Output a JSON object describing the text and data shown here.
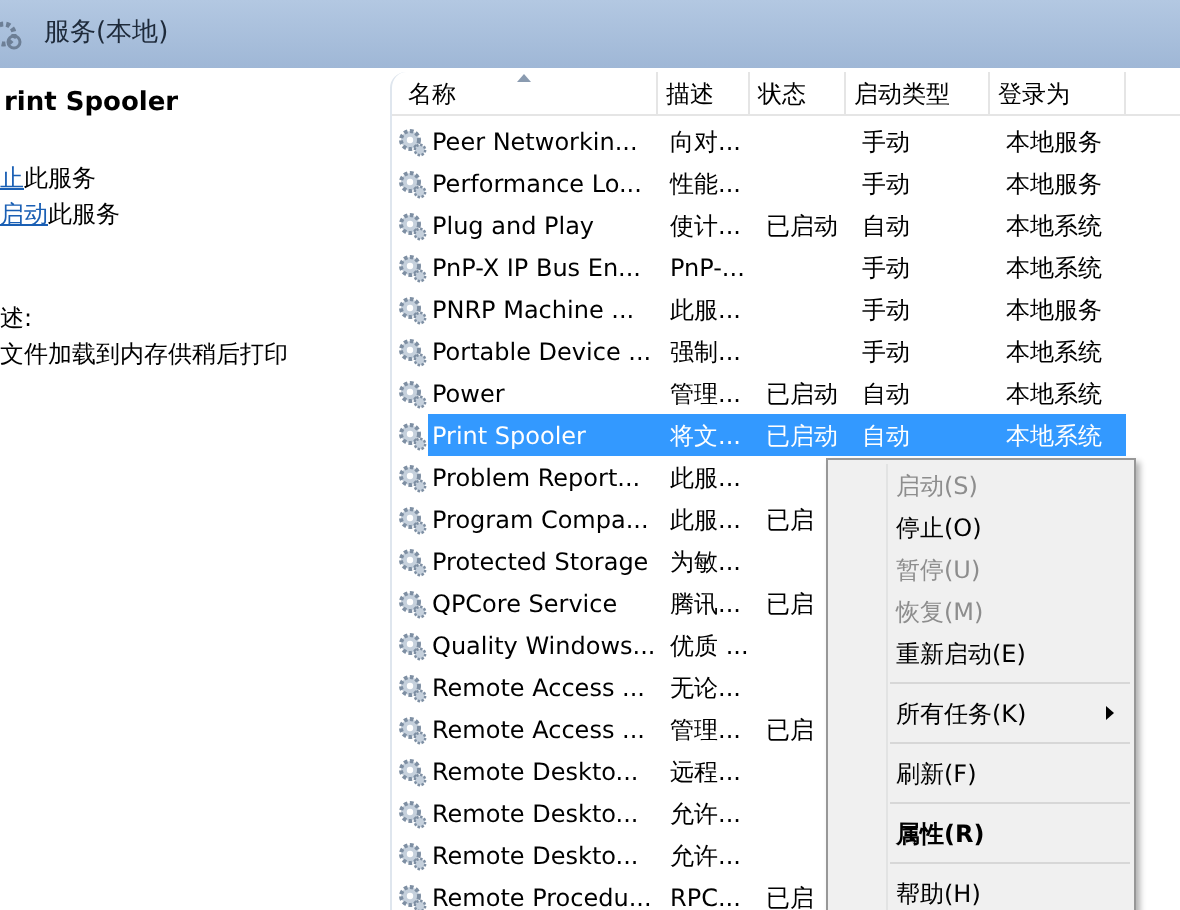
{
  "window": {
    "title": "服务(本地)"
  },
  "details": {
    "service_name": "rint Spooler",
    "actions": [
      {
        "link": "止",
        "text": "此服务"
      },
      {
        "link": "启动",
        "text": "此服务"
      }
    ],
    "description_label": "述:",
    "description": "文件加载到内存供稍后打印"
  },
  "table": {
    "columns": [
      {
        "label": "名称",
        "sorted": true
      },
      {
        "label": "描述",
        "sorted": false
      },
      {
        "label": "状态",
        "sorted": false
      },
      {
        "label": "启动类型",
        "sorted": false
      },
      {
        "label": "登录为",
        "sorted": false
      }
    ],
    "rows": [
      {
        "name": "Peer Networkin...",
        "description": "向对...",
        "status": "",
        "startup": "手动",
        "logon": "本地服务",
        "selected": false
      },
      {
        "name": "Performance Lo...",
        "description": "性能...",
        "status": "",
        "startup": "手动",
        "logon": "本地服务",
        "selected": false
      },
      {
        "name": "Plug and Play",
        "description": "使计...",
        "status": "已启动",
        "startup": "自动",
        "logon": "本地系统",
        "selected": false
      },
      {
        "name": "PnP-X IP Bus En...",
        "description": "PnP-...",
        "status": "",
        "startup": "手动",
        "logon": "本地系统",
        "selected": false
      },
      {
        "name": "PNRP Machine ...",
        "description": "此服...",
        "status": "",
        "startup": "手动",
        "logon": "本地服务",
        "selected": false
      },
      {
        "name": "Portable Device ...",
        "description": "强制...",
        "status": "",
        "startup": "手动",
        "logon": "本地系统",
        "selected": false
      },
      {
        "name": "Power",
        "description": "管理...",
        "status": "已启动",
        "startup": "自动",
        "logon": "本地系统",
        "selected": false
      },
      {
        "name": "Print Spooler",
        "description": "将文...",
        "status": "已启动",
        "startup": "自动",
        "logon": "本地系统",
        "selected": true
      },
      {
        "name": "Problem Report...",
        "description": "此服...",
        "status": "",
        "selected": false
      },
      {
        "name": "Program Compa...",
        "description": "此服...",
        "status": "已启",
        "selected": false
      },
      {
        "name": "Protected Storage",
        "description": "为敏...",
        "status": "",
        "selected": false
      },
      {
        "name": "QPCore Service",
        "description": "腾讯...",
        "status": "已启",
        "selected": false
      },
      {
        "name": "Quality Windows...",
        "description": "优质 ...",
        "status": "",
        "selected": false
      },
      {
        "name": "Remote Access ...",
        "description": "无论...",
        "status": "",
        "selected": false
      },
      {
        "name": "Remote Access ...",
        "description": "管理...",
        "status": "已启",
        "selected": false
      },
      {
        "name": "Remote Deskto...",
        "description": "远程...",
        "status": "",
        "selected": false
      },
      {
        "name": "Remote Deskto...",
        "description": "允许...",
        "status": "",
        "selected": false
      },
      {
        "name": "Remote Deskto...",
        "description": "允许...",
        "status": "",
        "selected": false
      },
      {
        "name": "Remote Procedu...",
        "description": "RPC...",
        "status": "已启",
        "selected": false
      }
    ]
  },
  "context_menu": {
    "items": [
      {
        "kind": "item",
        "label": "启动(S)",
        "disabled": true,
        "bold": false,
        "submenu": false
      },
      {
        "kind": "item",
        "label": "停止(O)",
        "disabled": false,
        "bold": false,
        "submenu": false
      },
      {
        "kind": "item",
        "label": "暂停(U)",
        "disabled": true,
        "bold": false,
        "submenu": false
      },
      {
        "kind": "item",
        "label": "恢复(M)",
        "disabled": true,
        "bold": false,
        "submenu": false
      },
      {
        "kind": "item",
        "label": "重新启动(E)",
        "disabled": false,
        "bold": false,
        "submenu": false
      },
      {
        "kind": "separator"
      },
      {
        "kind": "item",
        "label": "所有任务(K)",
        "disabled": false,
        "bold": false,
        "submenu": true
      },
      {
        "kind": "separator"
      },
      {
        "kind": "item",
        "label": "刷新(F)",
        "disabled": false,
        "bold": false,
        "submenu": false
      },
      {
        "kind": "separator"
      },
      {
        "kind": "item",
        "label": "属性(R)",
        "disabled": false,
        "bold": true,
        "submenu": false
      },
      {
        "kind": "separator"
      },
      {
        "kind": "item",
        "label": "帮助(H)",
        "disabled": false,
        "bold": false,
        "submenu": false
      }
    ]
  }
}
